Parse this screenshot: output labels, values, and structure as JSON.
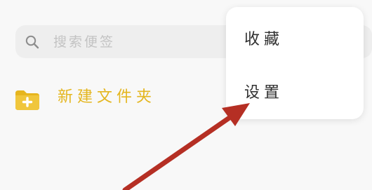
{
  "search": {
    "placeholder": "搜索便签",
    "icon": "search-icon"
  },
  "folder": {
    "label": "新建文件夹",
    "icon": "folder-plus-icon",
    "color": "#e4b61f"
  },
  "menu": {
    "items": [
      {
        "label": "收藏"
      },
      {
        "label": "设置"
      }
    ]
  },
  "annotation": {
    "color": "#b52f24"
  }
}
